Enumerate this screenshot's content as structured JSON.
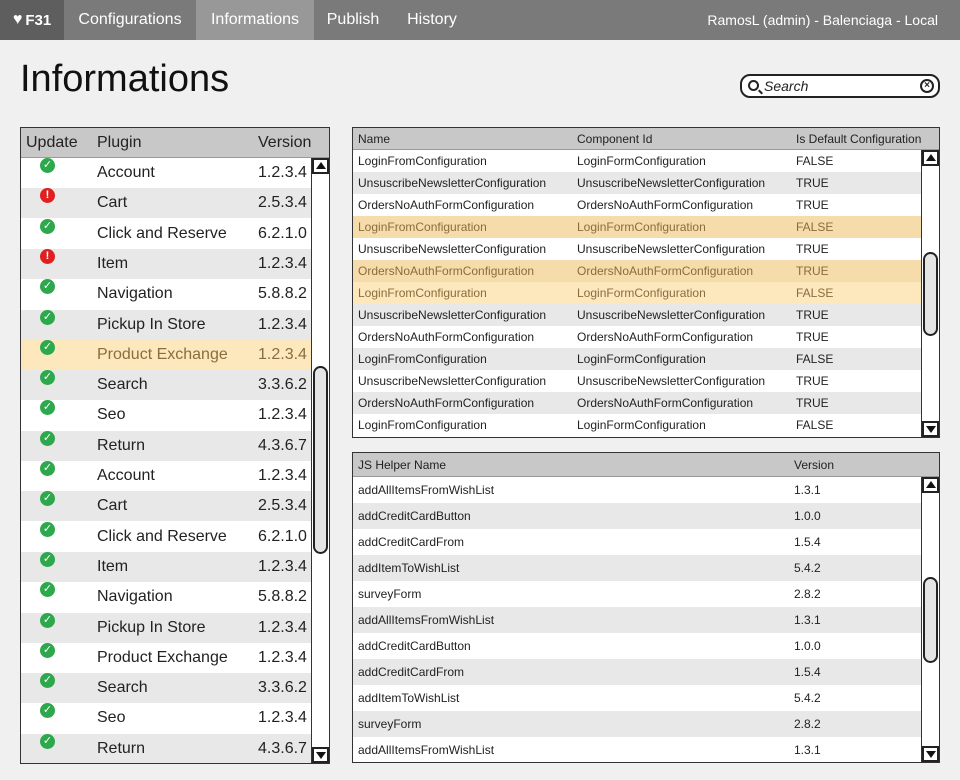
{
  "app": {
    "logo": "F31"
  },
  "nav": {
    "tabs": [
      "Configurations",
      "Informations",
      "Publish",
      "History"
    ],
    "active": 1
  },
  "user": {
    "info": "RamosL (admin) - Balenciaga - Local"
  },
  "page": {
    "title": "Informations"
  },
  "search": {
    "placeholder": "Search"
  },
  "plugins": {
    "headers": {
      "update": "Update",
      "plugin": "Plugin",
      "version": "Version"
    },
    "rows": [
      {
        "status": "ok",
        "name": "Account",
        "version": "1.2.3.4"
      },
      {
        "status": "error",
        "name": "Cart",
        "version": "2.5.3.4"
      },
      {
        "status": "ok",
        "name": "Click and Reserve",
        "version": "6.2.1.0"
      },
      {
        "status": "error",
        "name": "Item",
        "version": "1.2.3.4"
      },
      {
        "status": "ok",
        "name": "Navigation",
        "version": "5.8.8.2"
      },
      {
        "status": "ok",
        "name": "Pickup In Store",
        "version": "1.2.3.4"
      },
      {
        "status": "ok",
        "name": "Product Exchange",
        "version": "1.2.3.4",
        "highlight": true
      },
      {
        "status": "ok",
        "name": "Search",
        "version": "3.3.6.2"
      },
      {
        "status": "ok",
        "name": "Seo",
        "version": "1.2.3.4"
      },
      {
        "status": "ok",
        "name": "Return",
        "version": "4.3.6.7"
      },
      {
        "status": "ok",
        "name": "Account",
        "version": "1.2.3.4"
      },
      {
        "status": "ok",
        "name": "Cart",
        "version": "2.5.3.4"
      },
      {
        "status": "ok",
        "name": "Click and Reserve",
        "version": "6.2.1.0"
      },
      {
        "status": "ok",
        "name": "Item",
        "version": "1.2.3.4"
      },
      {
        "status": "ok",
        "name": "Navigation",
        "version": "5.8.8.2"
      },
      {
        "status": "ok",
        "name": "Pickup In Store",
        "version": "1.2.3.4"
      },
      {
        "status": "ok",
        "name": "Product Exchange",
        "version": "1.2.3.4"
      },
      {
        "status": "ok",
        "name": "Search",
        "version": "3.3.6.2"
      },
      {
        "status": "ok",
        "name": "Seo",
        "version": "1.2.3.4"
      },
      {
        "status": "ok",
        "name": "Return",
        "version": "4.3.6.7"
      }
    ]
  },
  "configurations": {
    "headers": {
      "name": "Name",
      "component": "Component Id",
      "default": "Is Default Configuration"
    },
    "rows": [
      {
        "name": "LoginFromConfiguration",
        "component": "LoginFormConfiguration",
        "default": "FALSE"
      },
      {
        "name": "UnsuscribeNewsletterConfiguration",
        "component": "UnsuscribeNewsletterConfiguration",
        "default": "TRUE"
      },
      {
        "name": "OrdersNoAuthFormConfiguration",
        "component": "OrdersNoAuthFormConfiguration",
        "default": "TRUE"
      },
      {
        "name": "LoginFromConfiguration",
        "component": "LoginFormConfiguration",
        "default": "FALSE",
        "highlight": "selected"
      },
      {
        "name": "UnsuscribeNewsletterConfiguration",
        "component": "UnsuscribeNewsletterConfiguration",
        "default": "TRUE"
      },
      {
        "name": "OrdersNoAuthFormConfiguration",
        "component": "OrdersNoAuthFormConfiguration",
        "default": "TRUE",
        "highlight": "selected"
      },
      {
        "name": "LoginFromConfiguration",
        "component": "LoginFormConfiguration",
        "default": "FALSE",
        "highlight": "hover"
      },
      {
        "name": "UnsuscribeNewsletterConfiguration",
        "component": "UnsuscribeNewsletterConfiguration",
        "default": "TRUE"
      },
      {
        "name": "OrdersNoAuthFormConfiguration",
        "component": "OrdersNoAuthFormConfiguration",
        "default": "TRUE"
      },
      {
        "name": "LoginFromConfiguration",
        "component": "LoginFormConfiguration",
        "default": "FALSE"
      },
      {
        "name": "UnsuscribeNewsletterConfiguration",
        "component": "UnsuscribeNewsletterConfiguration",
        "default": "TRUE"
      },
      {
        "name": "OrdersNoAuthFormConfiguration",
        "component": "OrdersNoAuthFormConfiguration",
        "default": "TRUE"
      },
      {
        "name": "LoginFromConfiguration",
        "component": "LoginFormConfiguration",
        "default": "FALSE"
      }
    ]
  },
  "js_helpers": {
    "headers": {
      "name": "JS Helper Name",
      "version": "Version"
    },
    "rows": [
      {
        "name": "addAllItemsFromWishList",
        "version": "1.3.1"
      },
      {
        "name": "addCreditCardButton",
        "version": "1.0.0"
      },
      {
        "name": "addCreditCardFrom",
        "version": "1.5.4"
      },
      {
        "name": "addItemToWishList",
        "version": "5.4.2"
      },
      {
        "name": "surveyForm",
        "version": "2.8.2"
      },
      {
        "name": "addAllItemsFromWishList",
        "version": "1.3.1"
      },
      {
        "name": "addCreditCardButton",
        "version": "1.0.0"
      },
      {
        "name": "addCreditCardFrom",
        "version": "1.5.4"
      },
      {
        "name": "addItemToWishList",
        "version": "5.4.2"
      },
      {
        "name": "surveyForm",
        "version": "2.8.2"
      },
      {
        "name": "addAllItemsFromWishList",
        "version": "1.3.1"
      }
    ]
  }
}
